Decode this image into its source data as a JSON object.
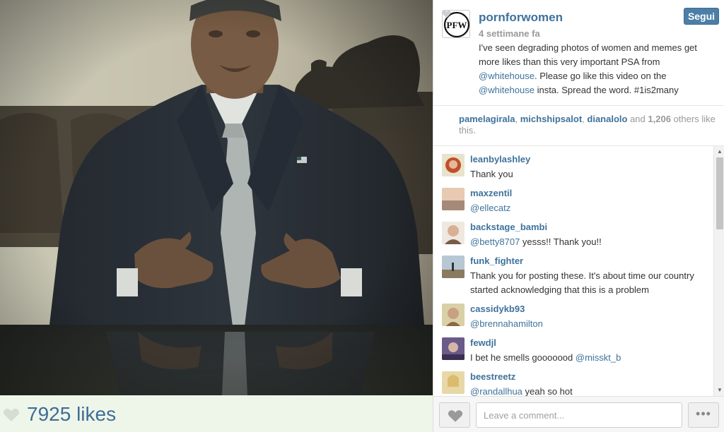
{
  "post": {
    "likes_label": "7925 likes"
  },
  "author": {
    "username": "pornforwomen",
    "time_ago": "4 settimane fa",
    "follow_label": "Segui"
  },
  "caption": {
    "part1": "I've seen degrading photos of women and memes get more likes than this very important PSA from ",
    "mention1": "@whitehouse",
    "part2": ". Please go like this video on the ",
    "mention2": "@whitehouse",
    "part3": " insta. Spread the word. #1is2many"
  },
  "likers": {
    "user1": "pamelagirala",
    "user2": "michshipsalot",
    "user3": "dianalolo",
    "and": "and",
    "count": "1,206",
    "others": "others like this."
  },
  "comments": [
    {
      "user": "leanbylashley",
      "text": "Thank you",
      "avatar_color": "#c0502a"
    },
    {
      "user": "maxzentil",
      "mention": "@ellecatz",
      "text": "",
      "avatar_color": "#d9b8a0"
    },
    {
      "user": "backstage_bambi",
      "mention": "@betty8707",
      "text": " yesss!! Thank you!!",
      "avatar_color": "#c9a88a"
    },
    {
      "user": "funk_fighter",
      "text": "Thank you for posting these. It's about time our country started acknowledging that this is a problem",
      "avatar_color": "#8aa0b0"
    },
    {
      "user": "cassidykb93",
      "mention": "@brennahamilton",
      "text": "",
      "avatar_color": "#a0805a"
    },
    {
      "user": "fewdjl",
      "text": "I bet he smells gooooood ",
      "mention_after": "@misskt_b",
      "avatar_color": "#7a6a9a"
    },
    {
      "user": "beestreetz",
      "mention": "@randallhua",
      "text": " yeah so hot",
      "avatar_color": "#d8c080"
    }
  ],
  "footer": {
    "comment_placeholder": "Leave a comment...",
    "more_label": "•••"
  },
  "scrollbar": {
    "up_arrow": "▲",
    "down_arrow": "▼"
  },
  "colors": {
    "link": "#3f729b",
    "follow_button": "#4c7ea8",
    "likes_bar": "#eef6ea"
  }
}
